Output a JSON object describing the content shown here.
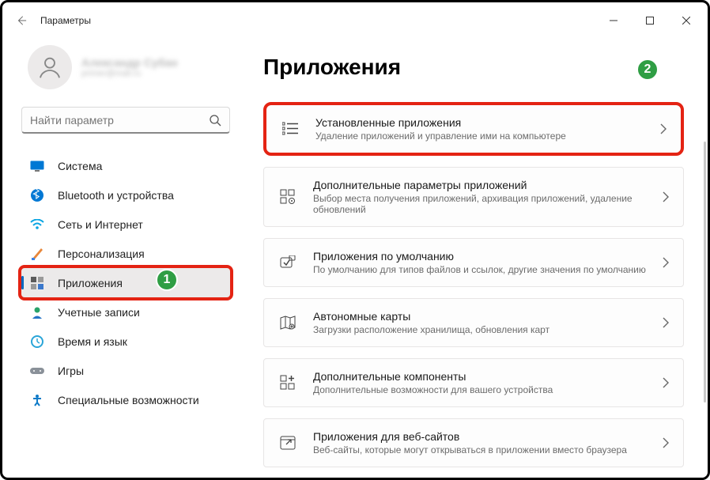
{
  "titlebar": {
    "title": "Параметры"
  },
  "user": {
    "name": "Александр Субан",
    "sub": "primer@mail.ru"
  },
  "search": {
    "placeholder": "Найти параметр"
  },
  "nav": [
    {
      "key": "system",
      "label": "Система"
    },
    {
      "key": "bluetooth",
      "label": "Bluetooth и устройства"
    },
    {
      "key": "network",
      "label": "Сеть и Интернет"
    },
    {
      "key": "personalization",
      "label": "Персонализация"
    },
    {
      "key": "apps",
      "label": "Приложения"
    },
    {
      "key": "accounts",
      "label": "Учетные записи"
    },
    {
      "key": "time",
      "label": "Время и язык"
    },
    {
      "key": "games",
      "label": "Игры"
    },
    {
      "key": "accessibility",
      "label": "Специальные возможности"
    }
  ],
  "page": {
    "title": "Приложения"
  },
  "items": [
    {
      "title": "Установленные приложения",
      "desc": "Удаление приложений и управление ими на компьютере"
    },
    {
      "title": "Дополнительные параметры приложений",
      "desc": "Выбор места получения приложений, архивация приложений, удаление обновлений"
    },
    {
      "title": "Приложения по умолчанию",
      "desc": "По умолчанию для типов файлов и ссылок, другие значения по умолчанию"
    },
    {
      "title": "Автономные карты",
      "desc": "Загрузки расположение хранилища, обновления карт"
    },
    {
      "title": "Дополнительные компоненты",
      "desc": "Дополнительные возможности для вашего устройства"
    },
    {
      "title": "Приложения для веб-сайтов",
      "desc": "Веб-сайты, которые могут открываться в приложении вместо браузера"
    }
  ],
  "badges": {
    "b1": "1",
    "b2": "2"
  }
}
